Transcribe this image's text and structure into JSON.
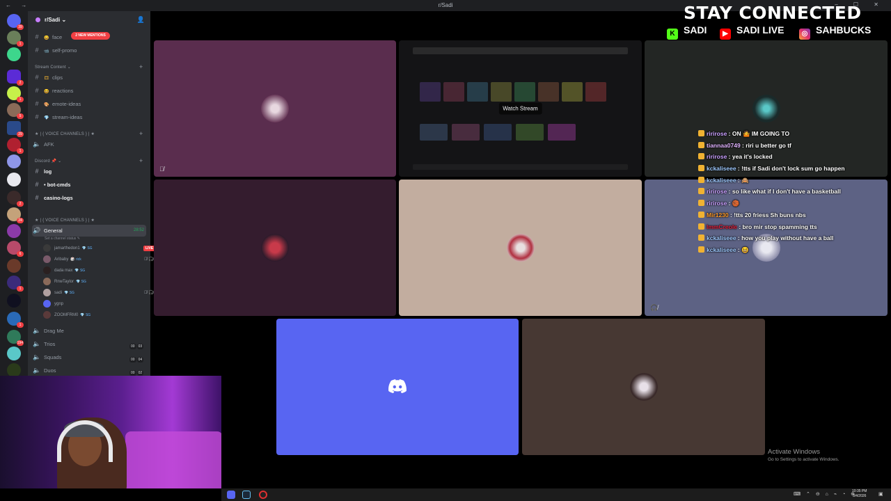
{
  "window": {
    "title": "r/Sadi",
    "nav": "← →",
    "controls": "–  ☐  ✕"
  },
  "server_rail": {
    "badges": [
      "39",
      "1",
      "2",
      "1",
      "5",
      "29",
      "1",
      "2",
      "24",
      "6",
      "1",
      "1",
      "194"
    ]
  },
  "server": {
    "name": "r/Sadi",
    "chevron": "⌄"
  },
  "mention_pill": "2 NEW MENTIONS",
  "channels_top": [
    {
      "name": "face",
      "emoji": "😀"
    },
    {
      "name": "self-promo",
      "emoji": "📹"
    }
  ],
  "categories": {
    "stream_content": "Stream Content",
    "voice_1": "★ | { VOICE CHANNELS } | ★",
    "discord": "Discord",
    "voice_2": "★ | { VOICE CHANNELS } | ★"
  },
  "stream_channels": [
    {
      "name": "clips",
      "emoji": "🎞"
    },
    {
      "name": "reactions",
      "emoji": "😆"
    },
    {
      "name": "emote-ideas",
      "emoji": "🎨"
    },
    {
      "name": "stream-ideas",
      "emoji": "💎"
    }
  ],
  "afk": "AFK",
  "discord_channels": [
    {
      "name": "log"
    },
    {
      "name": "• bot-cmds"
    },
    {
      "name": "casino-logs"
    }
  ],
  "general": {
    "name": "General",
    "timer": "28:52",
    "status": "Set a channel status"
  },
  "voice_members": [
    {
      "name": "jamarthedon1",
      "tag": "💎 SG",
      "live": "LIVE"
    },
    {
      "name": "Aribaby",
      "tag": "🎲 rick"
    },
    {
      "name": "dada max",
      "tag": "💎 SG"
    },
    {
      "name": "RnwTaylor",
      "tag": "💎 SG"
    },
    {
      "name": "sadi",
      "tag": "💎 SG"
    },
    {
      "name": "ygnp",
      "tag": ""
    },
    {
      "name": "ZOOMFRM0",
      "tag": "💎 SG"
    }
  ],
  "voice_channels": [
    {
      "name": "Drag Me",
      "a": "",
      "b": ""
    },
    {
      "name": "Trios",
      "a": "00",
      "b": "03"
    },
    {
      "name": "Squads",
      "a": "00",
      "b": "04"
    },
    {
      "name": "Duos",
      "a": "00",
      "b": "02"
    }
  ],
  "watch_stream": "Watch Stream",
  "overlay": {
    "title": "STAY CONNECTED",
    "kick": "SADI",
    "youtube": "SADI LIVE",
    "instagram": "SAHBUCKS"
  },
  "chat": [
    {
      "user": "ririrose",
      "color": "#c9a0ff",
      "text": ": ON 🤷 IM GOING TO"
    },
    {
      "user": "tiannaa0749",
      "color": "#e0b3ff",
      "text": ": riri u better go tf"
    },
    {
      "user": "ririrose",
      "color": "#c9a0ff",
      "text": ": yea it's locked"
    },
    {
      "user": "kckaliseee",
      "color": "#9ec9ff",
      "text": ": !tts if Sadi don't lock sum go happen"
    },
    {
      "user": "kckaliseee",
      "color": "#9ec9ff",
      "text": ": 🙈"
    },
    {
      "user": "ririrose",
      "color": "#c9a0ff",
      "text": ": so like what if I don't have a basketball"
    },
    {
      "user": "ririrose",
      "color": "#c9a0ff",
      "text": ": 🏀"
    },
    {
      "user": "Mir1230",
      "color": "#ff9c2a",
      "text": ": !tts 20 friess Sh buns nbs"
    },
    {
      "user": "lmmCreole",
      "color": "#e0203c",
      "text": ": bro mir stop spamming tts"
    },
    {
      "user": "kckaliseee",
      "color": "#9ec9ff",
      "text": ": how you play without have a ball"
    },
    {
      "user": "kckaliseee",
      "color": "#9ec9ff",
      "text": ": 😆"
    }
  ],
  "activate": {
    "line1": "Activate Windows",
    "line2": "Go to Settings to activate Windows."
  },
  "clock": {
    "time": "10:35 PM",
    "date": "3/4/2026"
  },
  "colors": {
    "blurple": "#5865f2",
    "sidebar": "#2b2d31",
    "rail": "#1e1f22",
    "live_red": "#f23f43"
  }
}
